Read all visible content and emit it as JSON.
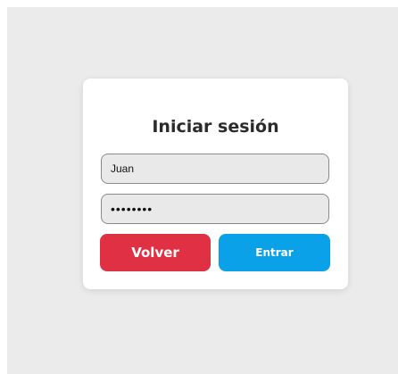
{
  "login": {
    "title": "Iniciar sesión",
    "username_value": "Juan",
    "password_value": "juan1234",
    "back_label": "Volver",
    "submit_label": "Entrar"
  },
  "colors": {
    "background": "#ebebeb",
    "card": "#ffffff",
    "back_button": "#e03144",
    "submit_button": "#0aa1e9"
  }
}
